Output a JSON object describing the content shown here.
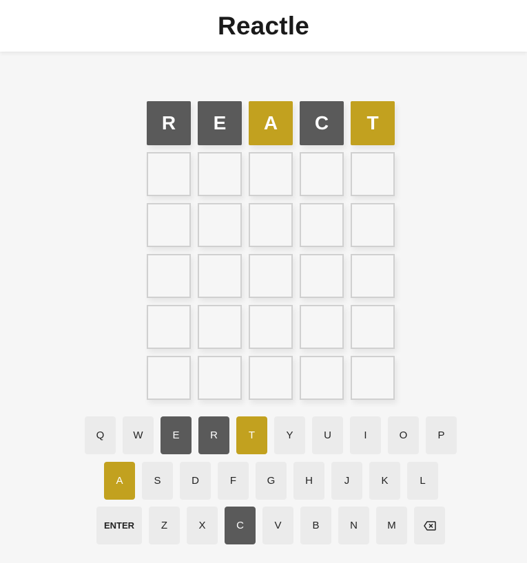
{
  "header": {
    "title": "Reactle"
  },
  "colors": {
    "absent": "#5a5a5a",
    "present": "#c2a11f",
    "empty": "#f6f6f6",
    "key": "#ebebeb"
  },
  "board": {
    "rows": [
      [
        {
          "letter": "R",
          "state": "absent"
        },
        {
          "letter": "E",
          "state": "absent"
        },
        {
          "letter": "A",
          "state": "present"
        },
        {
          "letter": "C",
          "state": "absent"
        },
        {
          "letter": "T",
          "state": "present"
        }
      ],
      [
        {
          "letter": "",
          "state": "empty"
        },
        {
          "letter": "",
          "state": "empty"
        },
        {
          "letter": "",
          "state": "empty"
        },
        {
          "letter": "",
          "state": "empty"
        },
        {
          "letter": "",
          "state": "empty"
        }
      ],
      [
        {
          "letter": "",
          "state": "empty"
        },
        {
          "letter": "",
          "state": "empty"
        },
        {
          "letter": "",
          "state": "empty"
        },
        {
          "letter": "",
          "state": "empty"
        },
        {
          "letter": "",
          "state": "empty"
        }
      ],
      [
        {
          "letter": "",
          "state": "empty"
        },
        {
          "letter": "",
          "state": "empty"
        },
        {
          "letter": "",
          "state": "empty"
        },
        {
          "letter": "",
          "state": "empty"
        },
        {
          "letter": "",
          "state": "empty"
        }
      ],
      [
        {
          "letter": "",
          "state": "empty"
        },
        {
          "letter": "",
          "state": "empty"
        },
        {
          "letter": "",
          "state": "empty"
        },
        {
          "letter": "",
          "state": "empty"
        },
        {
          "letter": "",
          "state": "empty"
        }
      ],
      [
        {
          "letter": "",
          "state": "empty"
        },
        {
          "letter": "",
          "state": "empty"
        },
        {
          "letter": "",
          "state": "empty"
        },
        {
          "letter": "",
          "state": "empty"
        },
        {
          "letter": "",
          "state": "empty"
        }
      ]
    ]
  },
  "keyboard": {
    "rows": [
      [
        {
          "label": "Q"
        },
        {
          "label": "W"
        },
        {
          "label": "E",
          "state": "absent"
        },
        {
          "label": "R",
          "state": "absent"
        },
        {
          "label": "T",
          "state": "present"
        },
        {
          "label": "Y"
        },
        {
          "label": "U"
        },
        {
          "label": "I"
        },
        {
          "label": "O"
        },
        {
          "label": "P"
        }
      ],
      [
        {
          "label": "A",
          "state": "present"
        },
        {
          "label": "S"
        },
        {
          "label": "D"
        },
        {
          "label": "F"
        },
        {
          "label": "G"
        },
        {
          "label": "H"
        },
        {
          "label": "J"
        },
        {
          "label": "K"
        },
        {
          "label": "L"
        }
      ],
      [
        {
          "label": "ENTER",
          "wide": true
        },
        {
          "label": "Z"
        },
        {
          "label": "X"
        },
        {
          "label": "C",
          "state": "absent"
        },
        {
          "label": "V"
        },
        {
          "label": "B"
        },
        {
          "label": "N"
        },
        {
          "label": "M"
        },
        {
          "label": "",
          "icon": "backspace-icon"
        }
      ]
    ]
  }
}
